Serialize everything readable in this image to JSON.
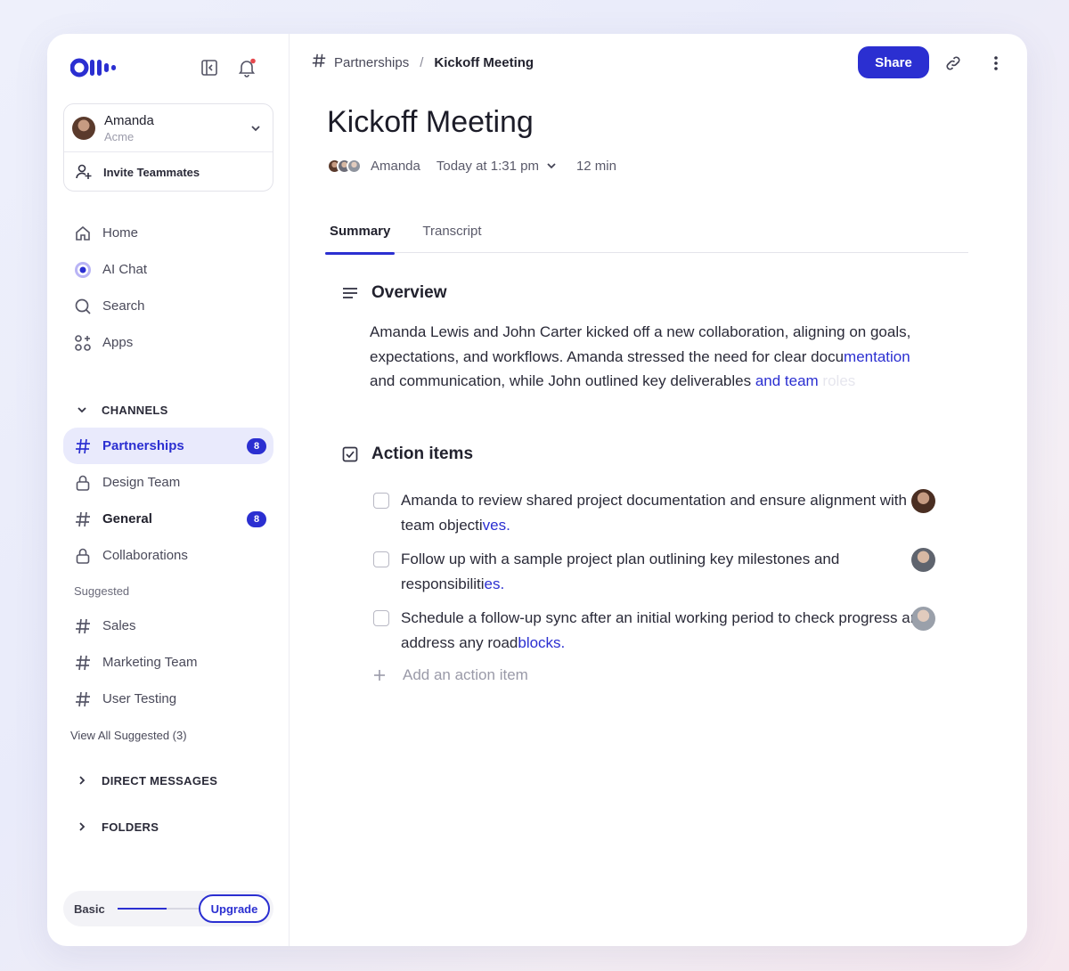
{
  "app": {
    "logo_text": "Otter"
  },
  "colors": {
    "accent": "#2b2fd1",
    "active_bg": "#e9eafc",
    "notification_dot": "#e5484d"
  },
  "account": {
    "name": "Amanda",
    "org": "Acme",
    "invite_label": "Invite Teammates"
  },
  "nav": [
    {
      "label": "Home",
      "icon": "home-icon"
    },
    {
      "label": "AI Chat",
      "icon": "ai-chat-icon"
    },
    {
      "label": "Search",
      "icon": "search-icon"
    },
    {
      "label": "Apps",
      "icon": "apps-icon"
    }
  ],
  "channels": {
    "heading": "CHANNELS",
    "items": [
      {
        "label": "Partnerships",
        "icon": "hash-icon",
        "badge": "8",
        "active": true
      },
      {
        "label": "Design Team",
        "icon": "lock-icon"
      },
      {
        "label": "General",
        "icon": "hash-icon",
        "badge": "8"
      },
      {
        "label": "Collaborations",
        "icon": "lock-icon"
      }
    ],
    "suggested_label": "Suggested",
    "suggested": [
      {
        "label": "Sales",
        "icon": "hash-icon"
      },
      {
        "label": "Marketing Team",
        "icon": "hash-icon"
      },
      {
        "label": "User Testing",
        "icon": "hash-icon"
      }
    ],
    "view_all": "View All Suggested (3)"
  },
  "direct_messages": {
    "heading": "DIRECT MESSAGES"
  },
  "folders": {
    "heading": "FOLDERS"
  },
  "plan": {
    "label": "Basic",
    "usage_fraction": 0.6,
    "upgrade_label": "Upgrade"
  },
  "breadcrumb": {
    "channel": "Partnerships",
    "separator": "/",
    "current": "Kickoff Meeting"
  },
  "toolbar": {
    "share_label": "Share"
  },
  "meeting": {
    "title": "Kickoff Meeting",
    "owner": "Amanda",
    "datetime": "Today at 1:31 pm",
    "duration": "12 min"
  },
  "tabs": [
    {
      "label": "Summary",
      "active": true
    },
    {
      "label": "Transcript",
      "active": false
    }
  ],
  "overview": {
    "heading": "Overview",
    "text_main": "Amanda Lewis and John Carter kicked off a new collaboration, aligning on goals, expectations, and workflows. Amanda stressed the need for clear docu",
    "text_highlight_1": "mentation",
    "text_main_2": "and communication, while John outlined key deliverables ",
    "text_highlight_2": "and team ",
    "text_fade": "roles"
  },
  "action_items": {
    "heading": "Action items",
    "items": [
      {
        "text": "Amanda to review shared project documentation and ensure alignment with team objecti",
        "text_hl": "ves."
      },
      {
        "text": "Follow up with a sample project plan outlining key milestones and responsibiliti",
        "text_hl": "es."
      },
      {
        "text": "Schedule a follow-up sync after an initial working period to check progress and address any road",
        "text_hl": "blocks."
      }
    ],
    "add_label": "Add an action item"
  }
}
